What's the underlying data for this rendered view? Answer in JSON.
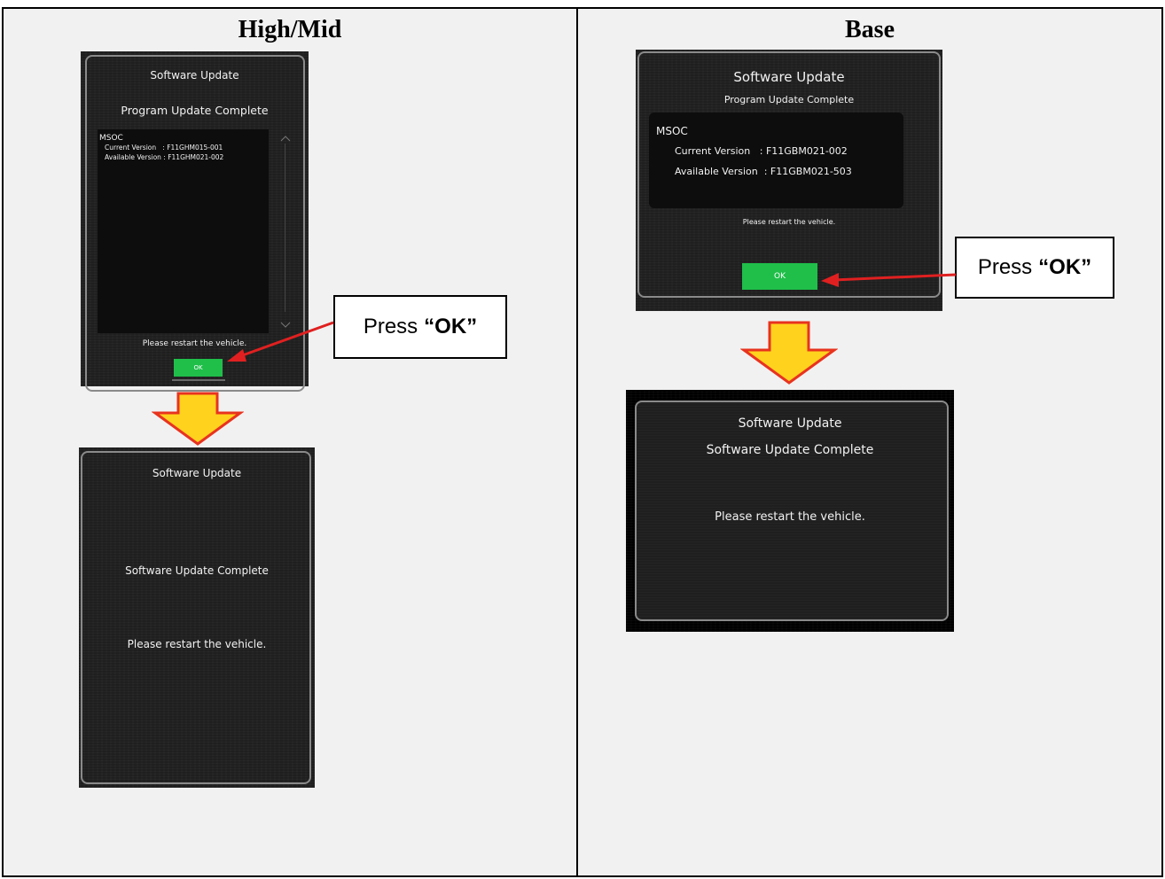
{
  "columns": {
    "left_heading": "High/Mid",
    "right_heading": "Base"
  },
  "highmid_screen1": {
    "title": "Software Update",
    "subtitle": "Program Update Complete",
    "module": "MSOC",
    "current_version_line": "Current Version   : F11GHM015-001",
    "available_version_line": "Available Version : F11GHM021-002",
    "restart_message": "Please restart the vehicle.",
    "ok_label": "OK"
  },
  "highmid_screen2": {
    "title": "Software Update",
    "complete_message": "Software Update Complete",
    "restart_message": "Please restart the vehicle."
  },
  "base_screen1": {
    "title": "Software Update",
    "subtitle": "Program Update Complete",
    "module": "MSOC",
    "current_version_line": "Current Version   : F11GBM021-002",
    "available_version_line": "Available Version  : F11GBM021-503",
    "restart_message": "Please restart the vehicle.",
    "ok_label": "OK"
  },
  "base_screen2": {
    "title": "Software Update",
    "complete_message": "Software Update Complete",
    "restart_message": "Please restart the vehicle."
  },
  "callouts": {
    "press_word": "Press",
    "ok_quoted": "“OK”"
  },
  "colors": {
    "ok_button": "#1fbf4a",
    "arrow_fill": "#ffd21e",
    "arrow_outline": "#e8331f",
    "pointer_arrow": "#e02020"
  }
}
